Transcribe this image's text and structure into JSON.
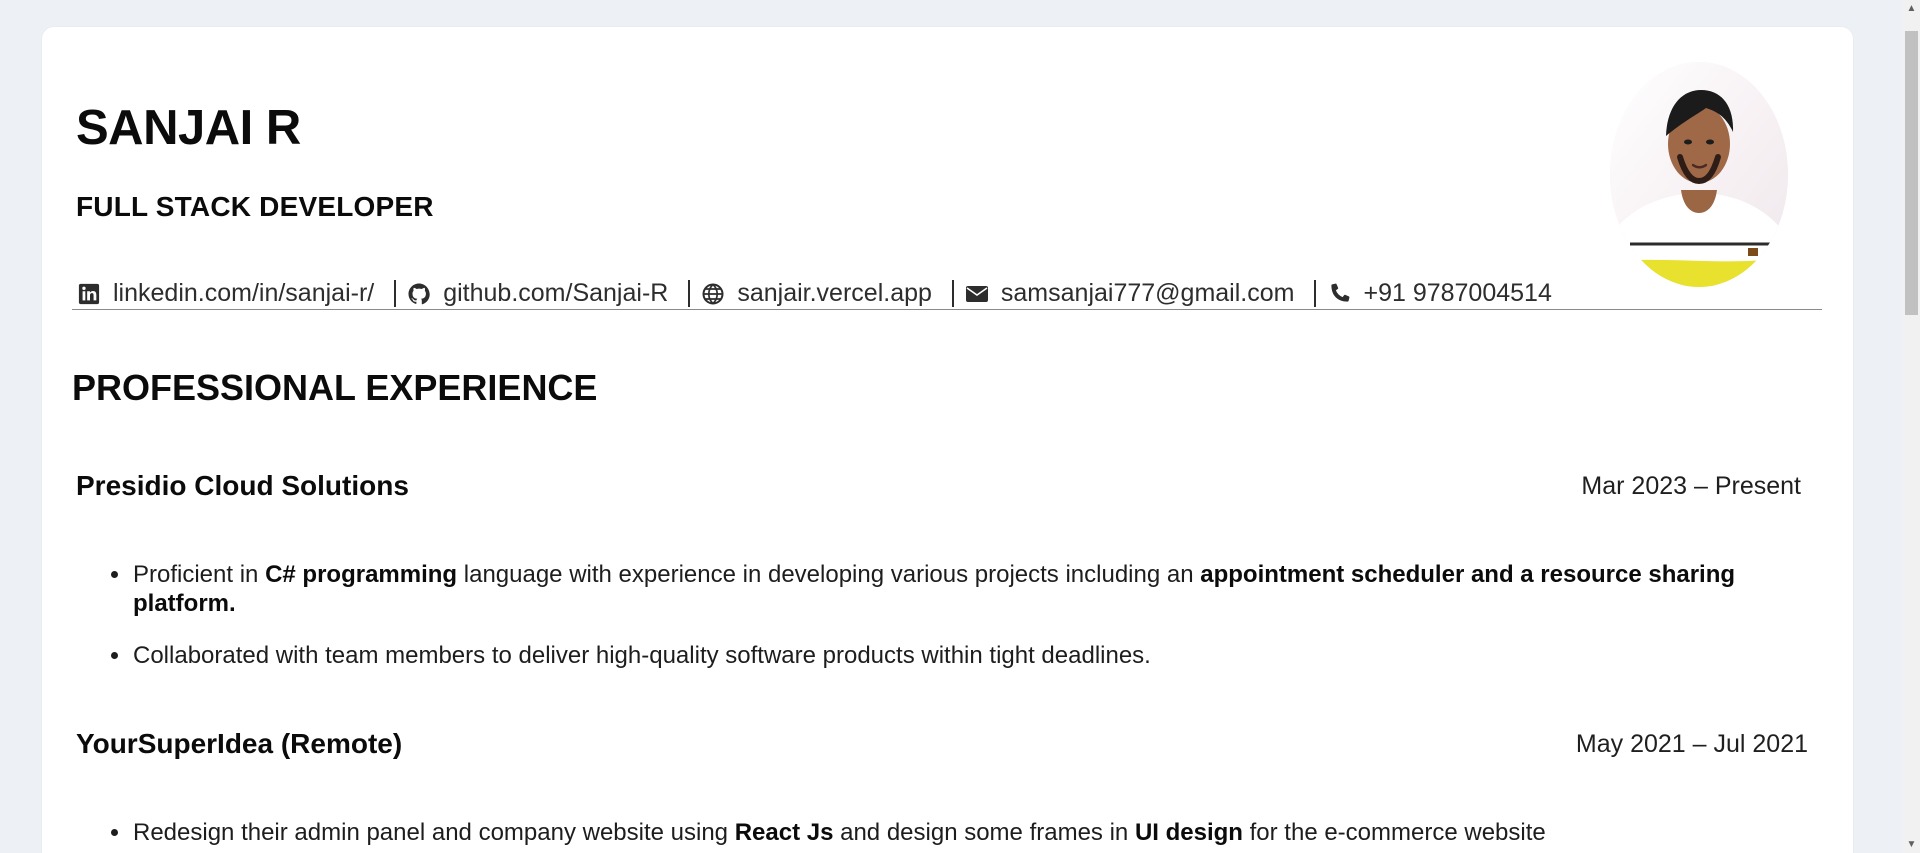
{
  "resume": {
    "name": "SANJAI R",
    "role": "FULL STACK DEVELOPER",
    "contacts": {
      "linkedin": "linkedin.com/in/sanjai-r/",
      "github": "github.com/Sanjai-R",
      "website": "sanjair.vercel.app",
      "email": "samsanjai777@gmail.com",
      "phone": "+91 9787004514"
    },
    "section_title": "PROFESSIONAL EXPERIENCE",
    "jobs": [
      {
        "company": "Presidio Cloud Solutions",
        "dates": "Mar 2023 – Present",
        "bullet1_parts": [
          "Proficient in ",
          "C# programming",
          " language with experience in developing various projects including an ",
          "appointment scheduler and a resource sharing platform."
        ],
        "bullet2": "Collaborated with team members to deliver high-quality software products within tight deadlines."
      },
      {
        "company": "YourSuperIdea (Remote)",
        "dates": "May 2021 – Jul 2021",
        "bullet1_parts": [
          "Redesign their admin panel and company website using ",
          "React Js",
          " and design some frames in ",
          "UI design",
          " for the e-commerce website"
        ]
      }
    ]
  },
  "icons": {
    "linkedin": "linkedin-icon",
    "github": "github-icon",
    "website": "globe-icon",
    "email": "envelope-icon",
    "phone": "phone-icon"
  },
  "colors": {
    "page_background": "#edf1f5",
    "card_background": "#ffffff",
    "text": "#111111",
    "divider": "#8a8a8a"
  }
}
